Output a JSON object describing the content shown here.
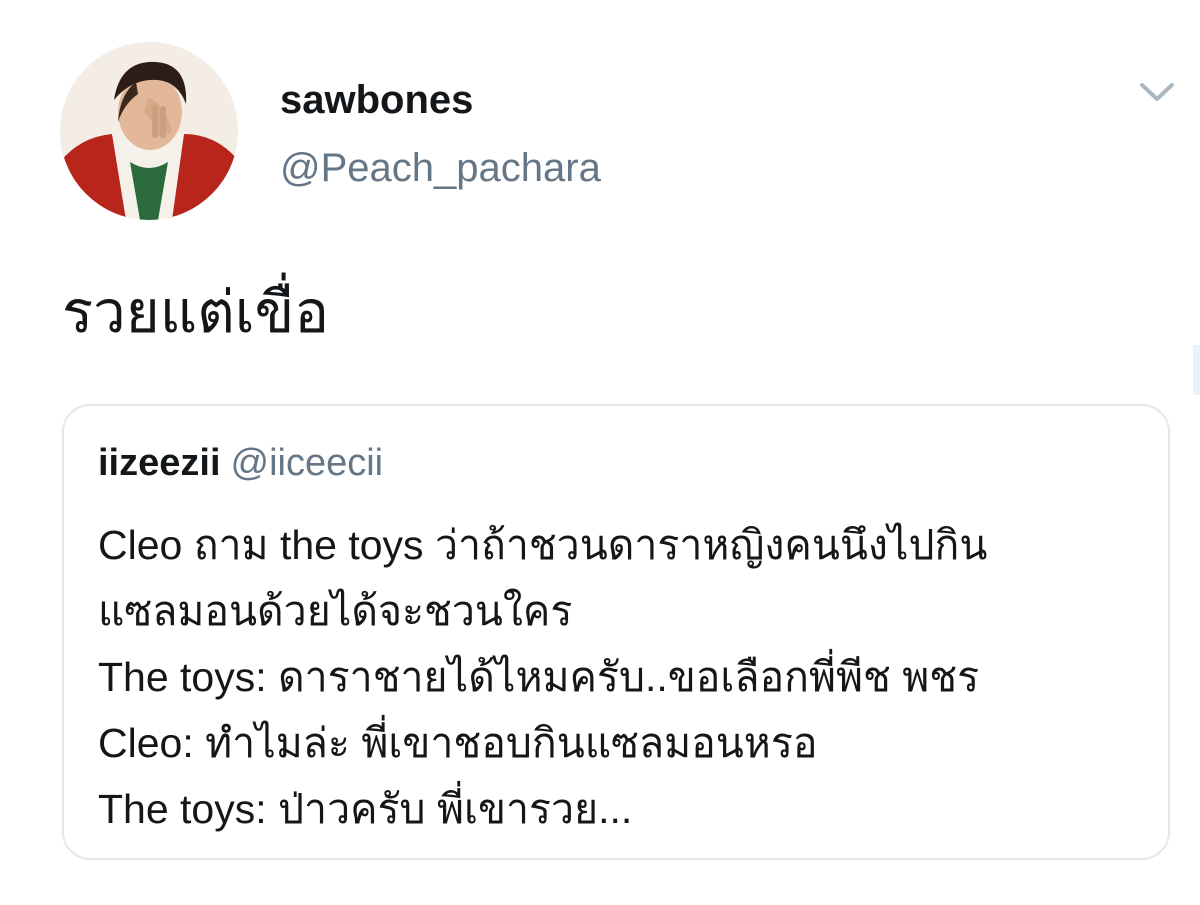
{
  "tweet": {
    "author": {
      "display_name": "sawbones",
      "handle": "@Peach_pachara",
      "avatar_icon": "profile-photo-person-red-jacket"
    },
    "text": "รวยแต่เขื่อ",
    "menu_icon": "chevron-down-icon",
    "quoted_tweet": {
      "author": {
        "display_name": "iizeezii",
        "handle": "@iiceecii"
      },
      "lines": [
        "Cleo ถาม the toys ว่าถ้าชวนดาราหญิงคนนึงไปกิน",
        "แซลมอนด้วยได้จะชวนใคร",
        "The toys: ดาราชายได้ไหมครับ..ขอเลือกพี่พีช พชร",
        "Cleo: ทำไมล่ะ พี่เขาชอบกินแซลมอนหรอ",
        "The toys: ป่าวครับ พี่เขารวย..."
      ]
    }
  },
  "colors": {
    "primary_text": "#14171a",
    "secondary_text": "#657786",
    "card_border": "#e1e8ed",
    "caret": "#aab8c2"
  }
}
